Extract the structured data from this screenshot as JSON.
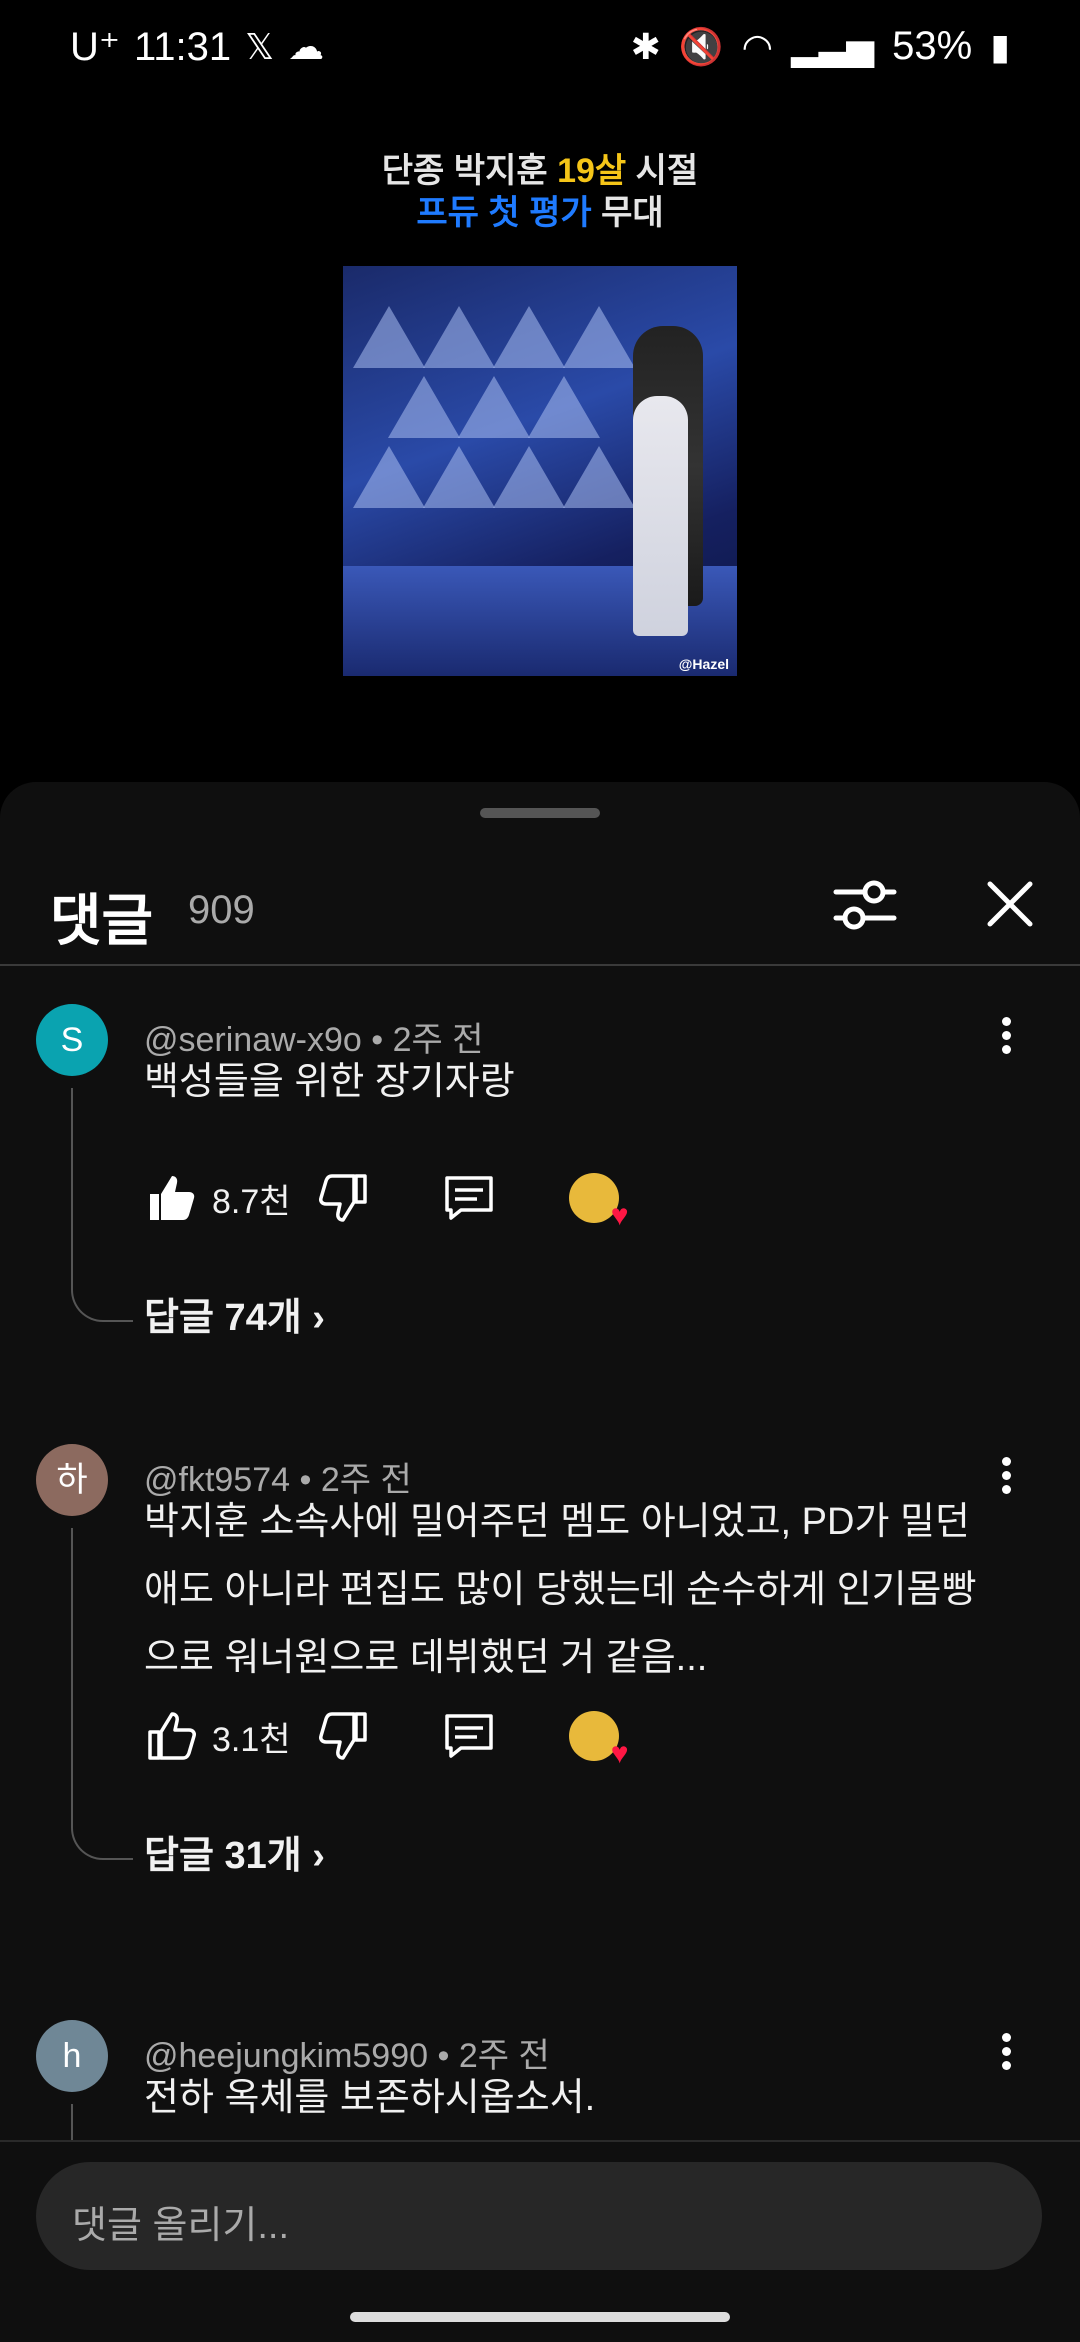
{
  "status_bar": {
    "carrier": "U⁺",
    "time": "11:31",
    "battery": "53%"
  },
  "video": {
    "title_line1_a": "단종 박지훈 ",
    "title_line1_hl": "19살",
    "title_line1_b": " 시절",
    "title_line2_a": "프듀 첫 평가",
    "title_line2_b": " 무대",
    "watermark": "@Hazel"
  },
  "comments_panel": {
    "title": "댓글",
    "count": "909"
  },
  "comments": [
    {
      "avatar_letter": "S",
      "avatar_color": "#0aa3b0",
      "author": "@serinaw-x9o",
      "age": " • 2주 전",
      "text": "백성들을 위한 장기자랑",
      "likes": "8.7천",
      "replies": "답글 74개 ›"
    },
    {
      "avatar_letter": "하",
      "avatar_color": "#8c6a5f",
      "author": "@fkt9574",
      "age": " • 2주 전",
      "text": "박지훈 소속사에 밀어주던 멤도 아니었고, PD가 밀던 애도 아니라 편집도 많이 당했는데 순수하게 인기몸빵으로 워너원으로 데뷔했던 거 같음...",
      "likes": "3.1천",
      "replies": "답글 31개 ›"
    },
    {
      "avatar_letter": "h",
      "avatar_color": "#6f8796",
      "author": "@heejungkim5990",
      "age": " • 2주 전",
      "text": "전하 옥체를 보존하시옵소서."
    }
  ],
  "input": {
    "placeholder": "댓글 올리기..."
  }
}
